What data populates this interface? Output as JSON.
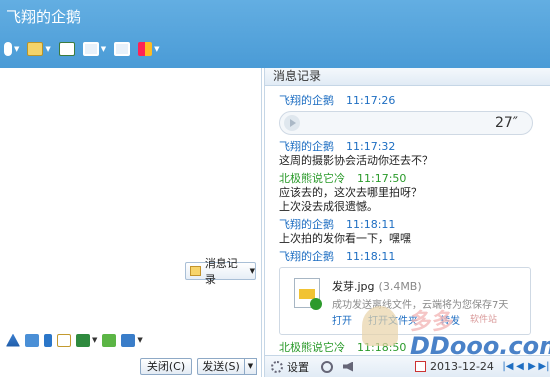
{
  "window": {
    "title": "飞翔的企鹅"
  },
  "toolbar": {
    "items": [
      "voice-icon",
      "folder-icon",
      "message-icon",
      "remote-icon",
      "screen-icon",
      "apps-icon"
    ]
  },
  "input_tools": {
    "history_button": "消息记录"
  },
  "bottom": {
    "close_label": "关闭(C)",
    "send_label": "发送(S)"
  },
  "history": {
    "title": "消息记录",
    "messages": [
      {
        "sender": "飞翔的企鹅",
        "time": "11:17:26",
        "voice_duration": "27″"
      },
      {
        "sender": "飞翔的企鹅",
        "time": "11:17:32",
        "text": "这周的摄影协会活动你还去不？"
      },
      {
        "sender": "北极熊说它冷",
        "time": "11:17:50",
        "line1": "应该去的，这次去哪里拍呀？",
        "line2": "上次没去成很遗憾。"
      },
      {
        "sender": "飞翔的企鹅",
        "time": "11:18:11",
        "text": "上次拍的发你看一下，嘿嘿"
      },
      {
        "sender": "飞翔的企鹅",
        "time": "11:18:11",
        "file": {
          "name": "发芽.jpg",
          "size": "(3.4MB)",
          "status": "成功发送离线文件，云端将为您保存7天",
          "open": "打开",
          "open_folder": "打开文件夹",
          "forward": "转发"
        }
      },
      {
        "sender": "北极熊说它冷",
        "time": "11:18:50"
      }
    ]
  },
  "footer": {
    "settings": "设置",
    "date": "2013-12-24",
    "nav": [
      "|◀",
      "◀",
      "▶",
      "▶|"
    ]
  },
  "watermark": {
    "brand": "多多",
    "sub": "软件站",
    "domain": "DDooo.com"
  }
}
